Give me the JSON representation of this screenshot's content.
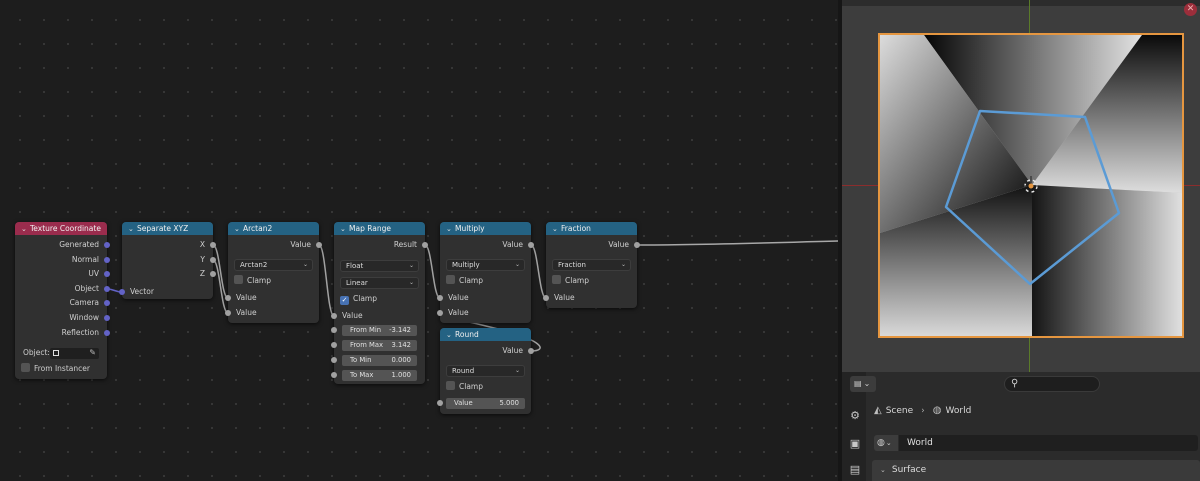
{
  "viewport": {
    "header_label": "",
    "close_glyph": "✕",
    "colors": {
      "camera_frame": "#e59640",
      "axis_x": "#8c2d2d",
      "axis_y": "#5b7b2a",
      "overlay_line": "#5b9bd5"
    }
  },
  "node_editor": {
    "wire_color": "#a1a1a1",
    "nodes": {
      "texture_coordinate": {
        "title": "Texture Coordinate",
        "outputs": [
          "Generated",
          "Normal",
          "UV",
          "Object",
          "Camera",
          "Window",
          "Reflection"
        ],
        "object_label": "Object:",
        "from_instancer_label": "From Instancer",
        "header_color": "#9a2c4d"
      },
      "separate_xyz": {
        "title": "Separate XYZ",
        "outputs": [
          "X",
          "Y",
          "Z"
        ],
        "input": "Vector"
      },
      "arctan2": {
        "title": "Arctan2",
        "output": "Value",
        "operation": "Arctan2",
        "clamp_label": "Clamp",
        "inputs": [
          "Value",
          "Value"
        ]
      },
      "map_range": {
        "title": "Map Range",
        "output": "Result",
        "data_type": "Float",
        "interpolation": "Linear",
        "clamp_label": "Clamp",
        "clamp_checked": true,
        "input": "Value",
        "fields": [
          {
            "label": "From Min",
            "value": "-3.142"
          },
          {
            "label": "From Max",
            "value": "3.142"
          },
          {
            "label": "To Min",
            "value": "0.000"
          },
          {
            "label": "To Max",
            "value": "1.000"
          }
        ]
      },
      "multiply": {
        "title": "Multiply",
        "output": "Value",
        "operation": "Multiply",
        "clamp_label": "Clamp",
        "inputs": [
          "Value",
          "Value"
        ]
      },
      "round": {
        "title": "Round",
        "output": "Value",
        "operation": "Round",
        "clamp_label": "Clamp",
        "field": {
          "label": "Value",
          "value": "5.000"
        }
      },
      "fraction": {
        "title": "Fraction",
        "output": "Value",
        "operation": "Fraction",
        "clamp_label": "Clamp",
        "input": "Value"
      }
    }
  },
  "properties": {
    "breadcrumb": [
      "Scene",
      "World"
    ],
    "world_name": "World",
    "panel": "Surface",
    "search_placeholder": ""
  },
  "icons": {
    "chevron": "⌄",
    "chevron_right": "›",
    "search": "⚲",
    "globe": "◍",
    "scene": "◭",
    "eyedropper": "✎",
    "check": "✓"
  }
}
